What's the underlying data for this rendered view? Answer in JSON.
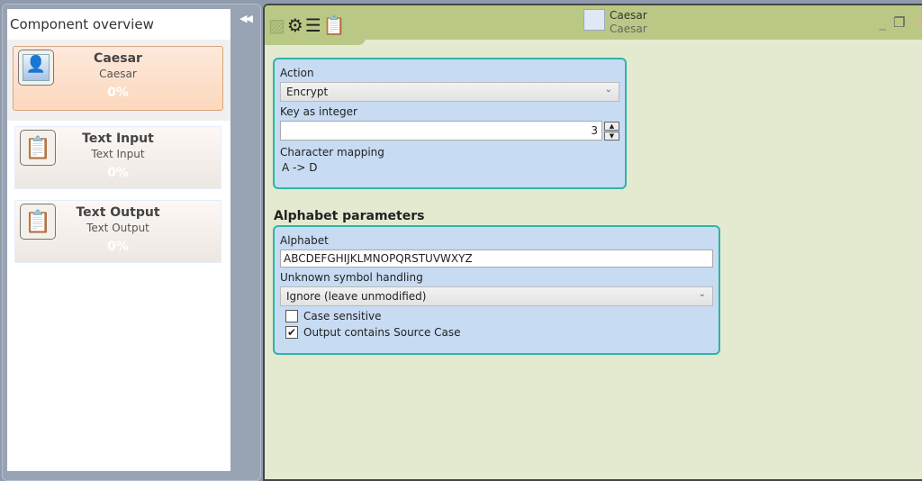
{
  "sidebar": {
    "title": "Component overview",
    "collapse_icon": "double-left-arrow-icon",
    "components": [
      {
        "title": "Caesar",
        "subtitle": "Caesar",
        "progress": "0%",
        "icon": "caesar-bust-icon",
        "selected": true
      },
      {
        "title": "Text Input",
        "subtitle": "Text Input",
        "progress": "0%",
        "icon": "clipboard-icon"
      },
      {
        "title": "Text Output",
        "subtitle": "Text Output",
        "progress": "0%",
        "icon": "clipboard-icon"
      }
    ]
  },
  "header": {
    "title": "Caesar",
    "subtitle": "Caesar",
    "tab_icons": [
      "image-icon",
      "gear-icon",
      "table-icon",
      "clipboard-list-icon"
    ]
  },
  "settings": {
    "action_label": "Action",
    "action_value": "Encrypt",
    "key_label": "Key as integer",
    "key_value": "3",
    "mapping_label": "Character mapping",
    "mapping_value": "A -> D"
  },
  "alphabet": {
    "section": "Alphabet parameters",
    "alphabet_label": "Alphabet",
    "alphabet_value": "ABCDEFGHIJKLMNOPQRSTUVWXYZ",
    "unknown_label": "Unknown symbol handling",
    "unknown_value": "Ignore (leave unmodified)",
    "case_label": "Case sensitive",
    "case_checked": false,
    "source_case_label": "Output contains Source Case",
    "source_case_checked": true
  },
  "colors": {
    "header": "#b9c985",
    "body": "#e4ead0",
    "box": "#c7dbf2",
    "box_border": "#2db5a6",
    "selected": "#fcd8bd"
  }
}
